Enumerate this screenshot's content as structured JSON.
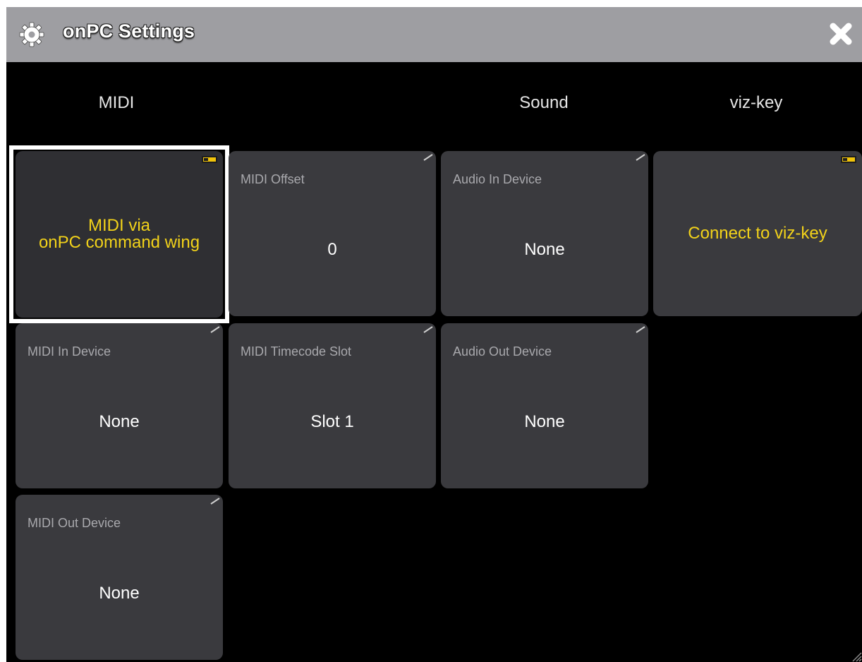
{
  "window": {
    "title": "onPC Settings",
    "colors": {
      "titlebar": "#9e9ea2",
      "background": "#000000",
      "tile": "#3a3a3e",
      "accent_yellow": "#f2d21a"
    }
  },
  "icons": {
    "title_icon": "gear-icon",
    "close": "close-icon"
  },
  "columns": {
    "midi": "MIDI",
    "sound": "Sound",
    "vizkey": "viz-key"
  },
  "tiles": {
    "midi_via_wing": {
      "line1": "MIDI via",
      "line2": "onPC command wing",
      "state": "on"
    },
    "midi_offset": {
      "label": "MIDI Offset",
      "value": "0"
    },
    "audio_in": {
      "label": "Audio In Device",
      "value": "None"
    },
    "connect_vizkey": {
      "value": "Connect to viz-key",
      "state": "on"
    },
    "midi_in": {
      "label": "MIDI In Device",
      "value": "None"
    },
    "midi_timecode": {
      "label": "MIDI Timecode Slot",
      "value": "Slot 1"
    },
    "audio_out": {
      "label": "Audio Out Device",
      "value": "None"
    },
    "midi_out": {
      "label": "MIDI Out Device",
      "value": "None"
    }
  }
}
